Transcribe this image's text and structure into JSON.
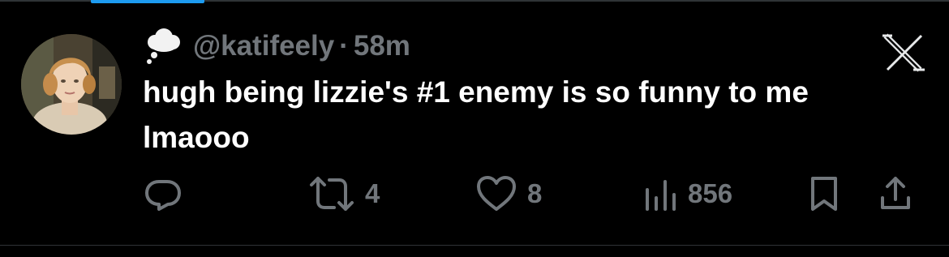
{
  "tweet": {
    "handle": "@katifeely",
    "separator": "·",
    "time": "58m",
    "text": "hugh being lizzie's #1 enemy is so funny to me\nlmaooo",
    "stats": {
      "reposts": "4",
      "likes": "8",
      "views": "856"
    }
  },
  "icons": {
    "badge": "thought-bubble-icon",
    "brand": "x-logo-icon",
    "reply": "reply-icon",
    "repost": "repost-icon",
    "like": "heart-icon",
    "views": "views-icon",
    "bookmark": "bookmark-icon",
    "share": "share-icon"
  },
  "colors": {
    "background": "#000000",
    "text_primary": "#ffffff",
    "text_secondary": "#71767b",
    "accent": "#1d9bf0",
    "divider": "#2f3336"
  }
}
